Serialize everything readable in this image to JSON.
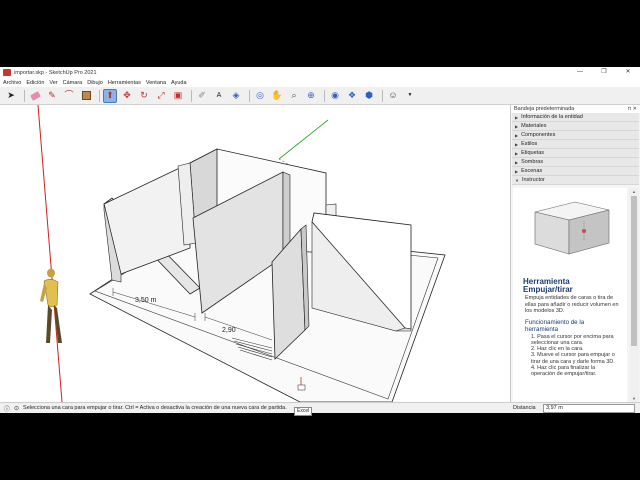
{
  "window": {
    "title": "importar.skp - SketchUp Pro 2021",
    "controls": [
      "—",
      "❐",
      "✕"
    ]
  },
  "menu": [
    "Archivo",
    "Edición",
    "Ver",
    "Cámara",
    "Dibujo",
    "Herramientas",
    "Ventana",
    "Ayuda"
  ],
  "toolbar": {
    "icons": [
      "select-icon",
      "eraser-icon",
      "pencil-icon",
      "arc-icon",
      "shape-icon",
      "push-pull-icon",
      "move-icon",
      "rotate-icon",
      "scale-icon",
      "offset-icon",
      "tape-measure-icon",
      "text-icon",
      "paint-icon",
      "orbit-icon",
      "pan-icon",
      "zoom-icon",
      "zoom-extents-icon",
      "warehouse-icon",
      "extension-icon",
      "share-icon",
      "account-icon"
    ]
  },
  "viewport": {
    "dim_1": "3,50 m",
    "dim_2": "2,90"
  },
  "tray": {
    "title": "Bandeja predeterminada",
    "panels": [
      {
        "label": "Información de la entidad",
        "open": false
      },
      {
        "label": "Materiales",
        "open": false
      },
      {
        "label": "Componentes",
        "open": false
      },
      {
        "label": "Estilos",
        "open": false
      },
      {
        "label": "Etiquetas",
        "open": false
      },
      {
        "label": "Sombras",
        "open": false
      },
      {
        "label": "Escenas",
        "open": false
      },
      {
        "label": "Instructor",
        "open": true
      }
    ],
    "instructor": {
      "heading": "Herramienta Empujar/tirar",
      "description": "Empuja entidades de caras o tira de ellas para añadir o reducir volumen en los modelos 3D.",
      "section": "Funcionamiento de la herramienta",
      "steps": [
        "1. Pasa el cursor por encima para seleccionar una cara.",
        "2. Haz clic en la cara.",
        "3. Mueve el cursor para empujar o tirar de una cara y darle forma 3D.",
        "4. Haz clic para finalizar la operación de empujar/tirar."
      ]
    }
  },
  "status": {
    "message": "Selecciona una cara para empujar o tirar. Ctrl = Activa o desactiva la creación de una nueva cara de partida.",
    "tooltip": "Excel",
    "measure_label": "Distancia",
    "measure_value": "3,97 m"
  },
  "colors": {
    "active_tool": "#8bb4e6",
    "axis_red": "#d02020",
    "axis_green": "#20a020",
    "axis_blue": "#2040d0",
    "instructor_heading": "#1b3b6f"
  }
}
